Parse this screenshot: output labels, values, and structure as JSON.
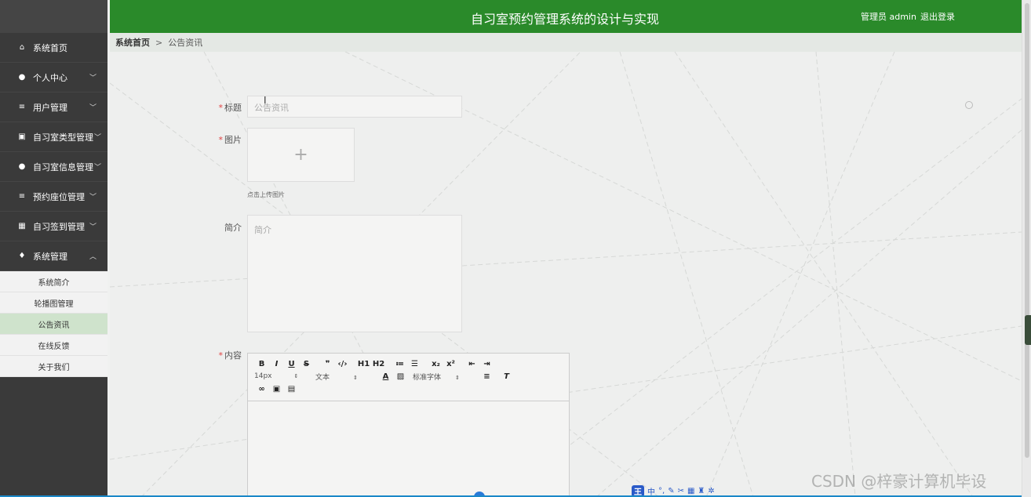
{
  "header": {
    "title": "自习室预约管理系统的设计与实现",
    "user": "管理员 admin",
    "logout": "退出登录"
  },
  "sidebar": {
    "items": [
      {
        "label": "系统首页",
        "icon": "home-icon"
      },
      {
        "label": "个人中心",
        "icon": "user-icon"
      },
      {
        "label": "用户管理",
        "icon": "list-icon"
      },
      {
        "label": "自习室类型管理",
        "icon": "clipboard-icon"
      },
      {
        "label": "自习室信息管理",
        "icon": "user-icon"
      },
      {
        "label": "预约座位管理",
        "icon": "list-icon"
      },
      {
        "label": "自习签到管理",
        "icon": "grid-icon"
      },
      {
        "label": "系统管理",
        "icon": "pin-icon"
      }
    ],
    "sub_items": [
      "系统简介",
      "轮播图管理",
      "公告资讯",
      "在线反馈",
      "关于我们"
    ],
    "active_sub": "公告资讯"
  },
  "breadcrumb": {
    "home": "系统首页",
    "separator": ">",
    "current": "公告资讯"
  },
  "form": {
    "title_label": "标题",
    "title_placeholder": "公告资讯",
    "image_label": "图片",
    "upload_hint": "点击上传图片",
    "intro_label": "简介",
    "intro_placeholder": "简介",
    "content_label": "内容"
  },
  "editor": {
    "row1": [
      "B",
      "I",
      "U",
      "S",
      "❞",
      "‹/›",
      "H1",
      "H2",
      "≔",
      "☰",
      "x₂",
      "x²",
      "⇤",
      "⇥"
    ],
    "font_size": "14px",
    "block_type": "文本",
    "font_family": "标准字体"
  },
  "ime": {
    "logo": "王",
    "mode": "中"
  },
  "watermark": "CSDN @梓豪计算机毕设",
  "colors": {
    "header": "#2a8a2a",
    "sidebar": "#3a3a3a",
    "active_sub": "#cfe3cc"
  }
}
